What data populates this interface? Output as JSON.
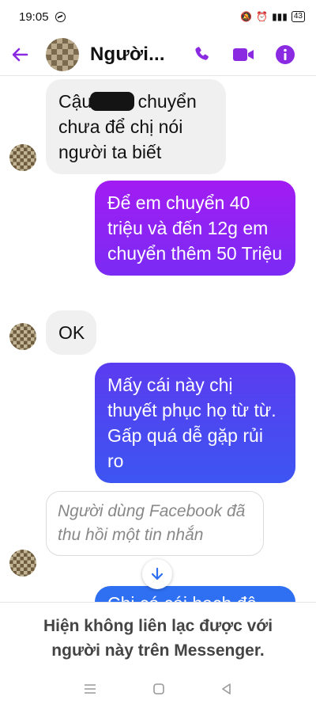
{
  "status_bar": {
    "time": "19:05",
    "battery": "43"
  },
  "header": {
    "contact_name": "Người..."
  },
  "messages": {
    "m1_before": "Cậu",
    "m1_after": "chuyển chưa để chị nói người ta biết",
    "m2": "Để em chuyển 40 triệu và đến 12g em chuyển thêm 50 Triệu",
    "m3": "OK",
    "m4": "Mấy cái này chị thuyết phục họ từ từ. Gấp quá dễ gặp rủi ro",
    "m5_unsent": "Người dùng Facebook đã thu hồi một tin nhắn",
    "m6_partial": "Chị có cái hạch đâ"
  },
  "footer": {
    "text": "Hiện không liên lạc được với người này trên Messenger."
  },
  "colors": {
    "accent": "#8a2be2",
    "bubble_in": "#f0f0f0",
    "outgoing_blue": "#2f6ff2"
  }
}
